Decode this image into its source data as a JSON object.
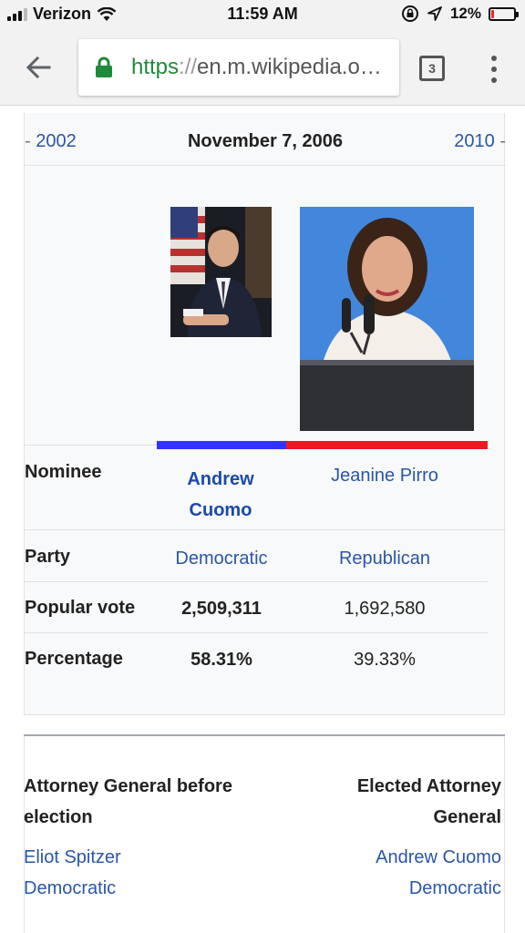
{
  "status_bar": {
    "carrier": "Verizon",
    "time": "11:59 AM",
    "battery": "12%",
    "battery_level": 0.12,
    "icons": [
      "signal-icon",
      "wifi-icon",
      "rotation-lock-icon",
      "location-arrow-icon",
      "battery-icon"
    ]
  },
  "toolbar": {
    "url_scheme": "https",
    "url_separator": "://",
    "url_rest": "en.m.wikipedia.o…",
    "tab_count": "3",
    "icons": [
      "back-arrow-icon",
      "lock-icon",
      "tab-switcher-icon",
      "overflow-menu-icon"
    ]
  },
  "infobox": {
    "nav": {
      "prev_dash": "-",
      "prev_year": "2002",
      "date": "November 7, 2006",
      "next_year": "2010",
      "next_dash": "-"
    },
    "colors": {
      "democratic": "#3333ff",
      "republican": "#e81b23",
      "link": "#2a56a8"
    },
    "rows": {
      "nominee": {
        "label": "Nominee",
        "candidate1_line1": "Andrew",
        "candidate1_line2": "Cuomo",
        "candidate2": "Jeanine Pirro"
      },
      "party": {
        "label": "Party",
        "candidate1": "Democratic",
        "candidate2": "Republican"
      },
      "popular_vote": {
        "label": "Popular vote",
        "candidate1": "2,509,311",
        "candidate2": "1,692,580"
      },
      "percentage": {
        "label": "Percentage",
        "candidate1": "58.31%",
        "candidate2": "39.33%"
      }
    }
  },
  "succession": {
    "left": {
      "heading": "Attorney General before election",
      "name": "Eliot Spitzer",
      "party": "Democratic"
    },
    "right": {
      "heading": "Elected Attorney General",
      "name": "Andrew Cuomo",
      "party": "Democratic"
    }
  }
}
